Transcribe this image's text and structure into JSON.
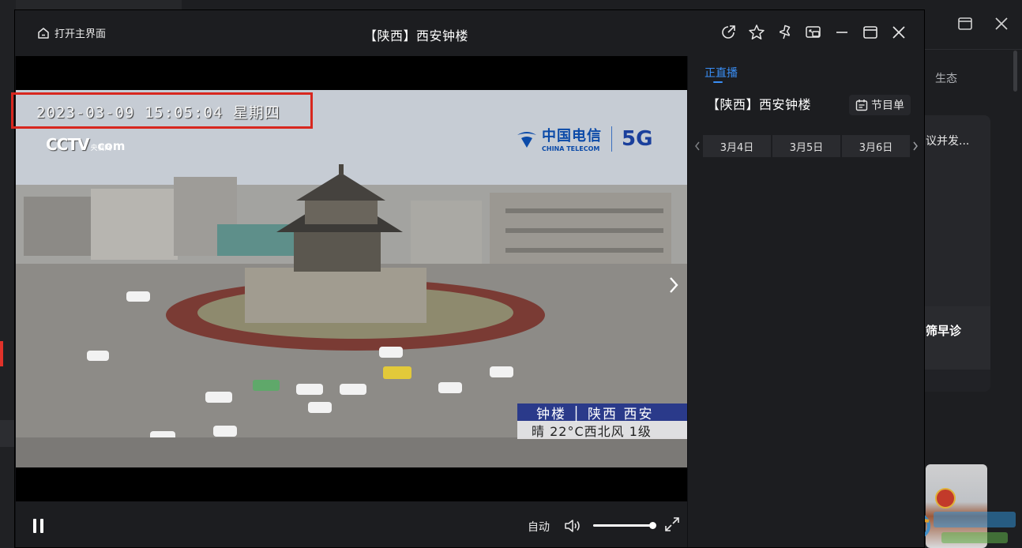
{
  "background_app": {
    "nav_item": "生态",
    "card_headline": "议并发...",
    "card_title": "筛早诊"
  },
  "player": {
    "open_main_label": "打开主界面",
    "title": "【陕西】西安钟楼",
    "titlebar_icons": [
      "share-icon",
      "star-icon",
      "pin-icon",
      "picture-in-picture-icon",
      "minimize-icon",
      "maximize-icon",
      "close-icon"
    ]
  },
  "video": {
    "timestamp": "2023-03-09 15:05:04 星期四",
    "broadcaster_logo": "CCTV",
    "broadcaster_sub": "央视网",
    "broadcaster_com": "com",
    "sponsor_cn": "中国电信",
    "sponsor_en": "CHINA TELECOM",
    "sponsor_5g": "5G",
    "location_line": "钟楼 │ 陕西 西安",
    "weather_line": "晴 22°C西北风 1级"
  },
  "controls": {
    "quality_label": "自动",
    "volume_level": 1.0
  },
  "side_panel": {
    "tab_label": "正直播",
    "channel_name": "【陕西】西安钟楼",
    "schedule_label": "节目单",
    "dates": [
      "3月4日",
      "3月5日",
      "3月6日"
    ]
  },
  "colors": {
    "accent_blue": "#3a8ff6",
    "highlight_red": "#d8271f",
    "panel_bg": "#1c1d20"
  }
}
